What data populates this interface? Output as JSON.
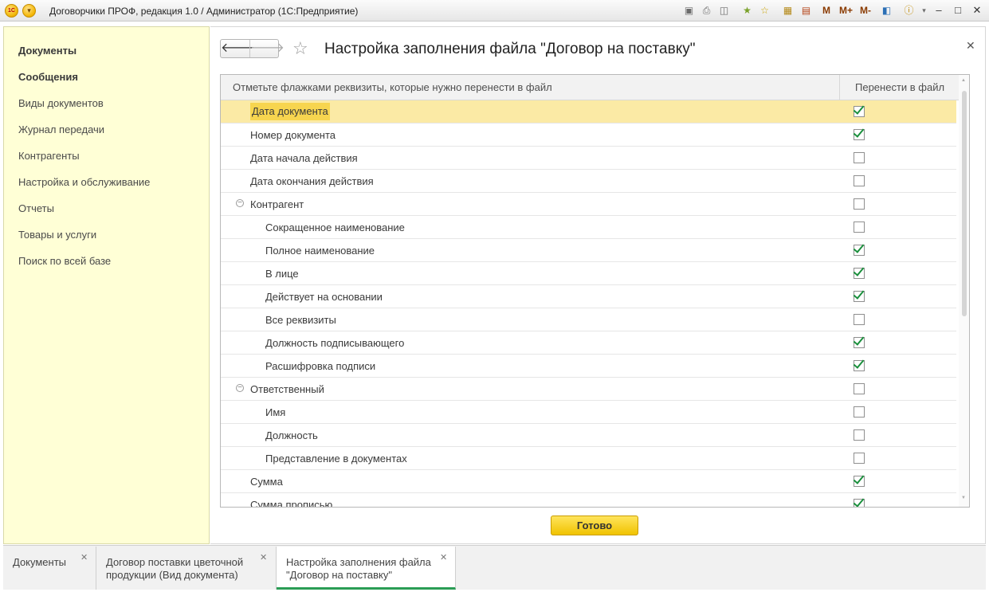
{
  "window": {
    "app_title": "Договорчики ПРОФ, редакция 1.0 / Администратор  (1С:Предприятие)",
    "logo_text": "1С",
    "toolbar_m": [
      "M",
      "M+",
      "M-"
    ],
    "icons": [
      "save-icon",
      "print-icon",
      "preview-icon",
      "favorite-icon",
      "bookmark-icon",
      "calculator-icon",
      "calendar-icon",
      "panel-icon",
      "info-icon",
      "minimize-icon",
      "maximize-icon",
      "close-icon"
    ]
  },
  "sidebar": {
    "items": [
      {
        "label": "Документы",
        "bold": true
      },
      {
        "label": "Сообщения",
        "bold": true
      },
      {
        "label": "Виды документов"
      },
      {
        "label": "Журнал передачи"
      },
      {
        "label": "Контрагенты"
      },
      {
        "label": "Настройка и обслуживание"
      },
      {
        "label": "Отчеты"
      },
      {
        "label": "Товары и услуги"
      },
      {
        "label": "Поиск по всей базе"
      }
    ]
  },
  "main": {
    "title": "Настройка заполнения файла \"Договор на поставку\"",
    "table": {
      "col1": "Отметьте флажками реквизиты, которые нужно перенести в файл",
      "col2": "Перенести в файл",
      "rows": [
        {
          "label": "Дата документа",
          "level": 0,
          "checked": true,
          "selected": true
        },
        {
          "label": "Номер документа",
          "level": 0,
          "checked": true
        },
        {
          "label": "Дата начала действия",
          "level": 0,
          "checked": false
        },
        {
          "label": "Дата окончания действия",
          "level": 0,
          "checked": false
        },
        {
          "label": "Контрагент",
          "level": 0,
          "checked": false,
          "group": true
        },
        {
          "label": "Сокращенное наименование",
          "level": 1,
          "checked": false
        },
        {
          "label": "Полное наименование",
          "level": 1,
          "checked": true
        },
        {
          "label": "В лице",
          "level": 1,
          "checked": true
        },
        {
          "label": "Действует на основании",
          "level": 1,
          "checked": true
        },
        {
          "label": "Все реквизиты",
          "level": 1,
          "checked": false
        },
        {
          "label": "Должность подписывающего",
          "level": 1,
          "checked": true
        },
        {
          "label": "Расшифровка подписи",
          "level": 1,
          "checked": true
        },
        {
          "label": "Ответственный",
          "level": 0,
          "checked": false,
          "group": true
        },
        {
          "label": "Имя",
          "level": 1,
          "checked": false
        },
        {
          "label": "Должность",
          "level": 1,
          "checked": false
        },
        {
          "label": "Представление в документах",
          "level": 1,
          "checked": false
        },
        {
          "label": "Сумма",
          "level": 0,
          "checked": true
        },
        {
          "label": "Сумма прописью",
          "level": 0,
          "checked": true
        }
      ]
    },
    "done_label": "Готово"
  },
  "tabs": [
    {
      "label": "Документы",
      "active": false
    },
    {
      "label": "Договор поставки цветочной\nпродукции (Вид документа)",
      "active": false
    },
    {
      "label": "Настройка заполнения файла\n\"Договор на поставку\"",
      "active": true
    }
  ],
  "colors": {
    "sidebar_bg": "#ffffd6",
    "selected_row": "#fbeaa5",
    "highlight": "#f7d54f",
    "check": "#1a8f3c",
    "done_button": "#f5cf1f",
    "active_tab_underline": "#2a9d55"
  }
}
